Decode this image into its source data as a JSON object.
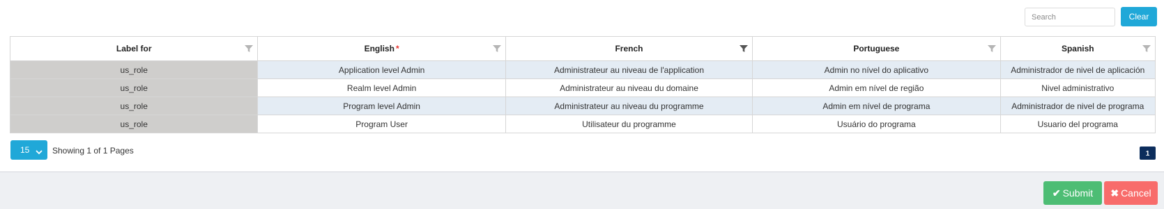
{
  "toolbar": {
    "search_placeholder": "Search",
    "clear_label": "Clear"
  },
  "table": {
    "columns": [
      {
        "label": "Label for",
        "required": false,
        "filter_active": false
      },
      {
        "label": "English",
        "required": true,
        "filter_active": false
      },
      {
        "label": "French",
        "required": false,
        "filter_active": true
      },
      {
        "label": "Portuguese",
        "required": false,
        "filter_active": false
      },
      {
        "label": "Spanish",
        "required": false,
        "filter_active": false
      }
    ],
    "required_marker": "*",
    "rows": [
      [
        "us_role",
        "Application level Admin",
        "Administrateur au niveau de l'application",
        "Admin no nível do aplicativo",
        "Administrador de nivel de aplicación"
      ],
      [
        "us_role",
        "Realm level Admin",
        "Administrateur au niveau du domaine",
        "Admin em nível de região",
        "Nivel administrativo"
      ],
      [
        "us_role",
        "Program level Admin",
        "Administrateur au niveau du programme",
        "Admin em nível de programa",
        "Administrador de nivel de programa"
      ],
      [
        "us_role",
        "Program User",
        "Utilisateur du programme",
        "Usuário do programa",
        "Usuario del programa"
      ]
    ]
  },
  "pagination": {
    "page_size": "15",
    "showing_text": "Showing 1 of 1 Pages",
    "current_page": "1"
  },
  "actions": {
    "submit_label": "Submit",
    "cancel_label": "Cancel"
  },
  "colors": {
    "accent": "#20a8d8",
    "submit": "#4dbd74",
    "cancel": "#f86c6b",
    "page_active": "#0c2d5c",
    "row_alt": "#e4ecf4",
    "label_col": "#cfcecc",
    "filter_inactive": "#b5b5b5",
    "filter_active": "#555555"
  },
  "icons": {
    "filter": "filter-icon",
    "chevron": "chevron-down-icon",
    "check": "check-icon",
    "close": "close-icon"
  }
}
